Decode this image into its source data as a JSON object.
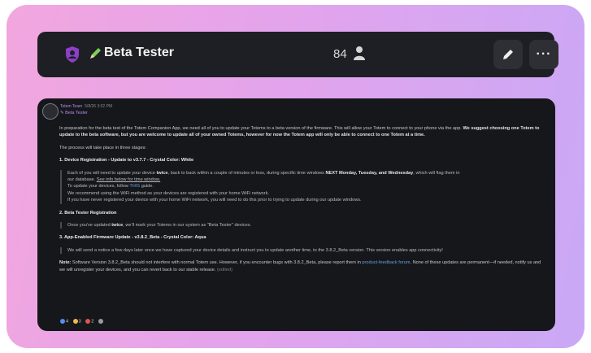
{
  "header": {
    "title": "Beta Tester",
    "member_count": "84",
    "more_label": "···"
  },
  "post": {
    "author": "Totem Team",
    "time": "5/8/26 3:02 PM",
    "reply_target": "Beta Tester",
    "intro": "In preparation for the beta test of the Totem Companion App, we need all of you to update your Totems to a beta version of the firmware. This will allow your Totem to connect to your phone via the app.",
    "intro_bold": "We suggest choosing one Totem to update to the beta software, but you are welcome to update all of your owned Totems, however for now the Totem app will only be able to connect to one Totem at a time.",
    "stages_intro": "The process will take place in three stages:",
    "stage1_title": "1. Device Registration - Update to v3.7.7 - Crystal Color: White",
    "stage1_l1a": "Each of you will need to update your device",
    "stage1_l1b": "twice",
    "stage1_l1c": ", back to back within a couple of minutes or less, during specific time windows",
    "stage1_l1d": "NEXT Monday, Tuesday, and Wednesday",
    "stage1_l1e": ", which will flag them in",
    "stage1_l2a": "our database.",
    "stage1_l2b": "See info below for time window.",
    "stage1_l3a": "To update your devices, follow",
    "stage1_l3b": "THIS",
    "stage1_l3c": "guide.",
    "stage1_l4": "We recommend using the WiFi method as your devices are registered with your home WiFi network.",
    "stage1_l5": "If you have never registered your device with your home WiFi network, you will need to do this prior to trying to update during our update windows.",
    "stage2_title": "2. Beta Tester Registration",
    "stage2_l1a": "Once you've updated",
    "stage2_l1b": "twice",
    "stage2_l1c": ", we'll mark your Totems in our system as \"Beta Tester\" devices.",
    "stage3_title": "3. App-Enabled Firmware Update - v3.8.2_Beta - Crystal Color: Aqua",
    "stage3_l1": "We will send a notice a few days later once we have captured your device details and instruct you to update another time, to the 3.8.2_Beta version. This version enables app connectivity!",
    "note_label": "Note:",
    "note_a": "Software Version 3.8.2_Beta should not interfere with normal Totem use. However, if you encounter bugs with 3.8.2_Beta, please report them in",
    "note_link": "product-feedback forum",
    "note_b": ". None of these updates are permanent—if needed, notify us and we will unregister your devices, and you can revert back to our stable release.",
    "edited": "(edited)",
    "reactions": [
      {
        "emoji": "blue-heart",
        "count": "4"
      },
      {
        "emoji": "clap",
        "count": "3"
      },
      {
        "emoji": "red-heart",
        "count": "2"
      },
      {
        "emoji": "add-reaction",
        "count": ""
      }
    ]
  }
}
